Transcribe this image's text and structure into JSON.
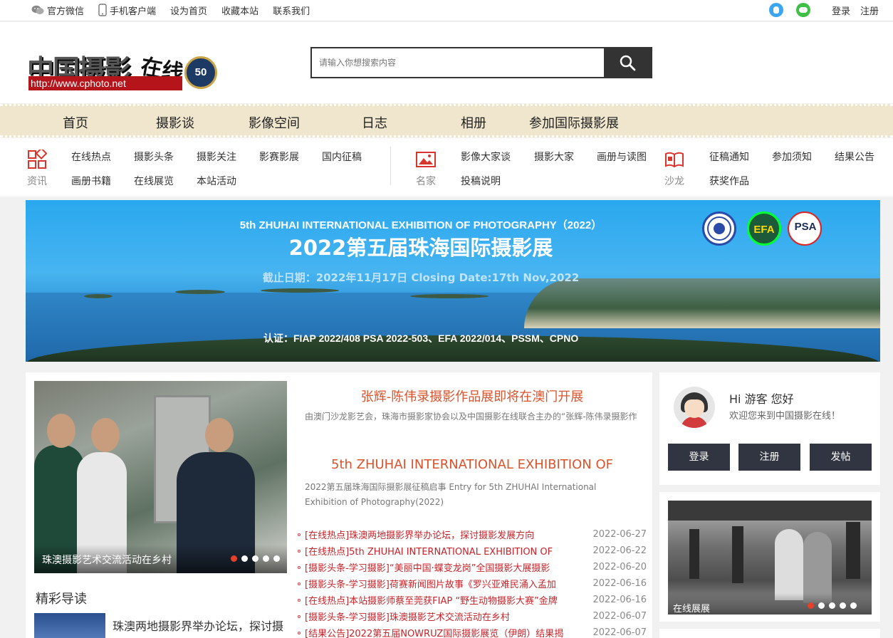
{
  "topbar": {
    "wechat": "官方微信",
    "mobile": "手机客户端",
    "set_home": "设为首页",
    "bookmark": "收藏本站",
    "contact": "联系我们",
    "login": "登录",
    "register": "注册"
  },
  "header": {
    "logo_text": "中国摄影",
    "logo_script": "在线",
    "logo_url": "http://www.cphoto.net",
    "badge": "50",
    "search_placeholder": "请输入你想搜索内容"
  },
  "main_nav": [
    "首页",
    "摄影谈",
    "影像空间",
    "日志",
    "相册",
    "参加国际摄影展"
  ],
  "sub_nav": {
    "news": {
      "label": "资讯",
      "row1": [
        "在线热点",
        "摄影头条",
        "摄影关注",
        "影赛影展",
        "国内征稿"
      ],
      "row2": [
        "画册书籍",
        "在线展览",
        "本站活动"
      ]
    },
    "masters": {
      "label": "名家",
      "row1": [
        "影像大家谈",
        "摄影大家",
        "画册与读图"
      ],
      "row2": [
        "投稿说明"
      ]
    },
    "salon": {
      "label": "沙龙",
      "row1": [
        "征稿通知",
        "参加须知",
        "结果公告"
      ],
      "row2": [
        "获奖作品"
      ]
    }
  },
  "banner": {
    "title_en": "5th ZHUHAI INTERNATIONAL EXHIBITION OF PHOTOGRAPHY（2022）",
    "title_cn": "2022第五届珠海国际摄影展",
    "deadline": "截止日期：2022年11月17日    Closing Date:17th Nov,2022",
    "cert": "认证：FIAP 2022/408 PSA 2022-503、EFA 2022/014、PSSM、CPNO",
    "psa_logo": "PSA"
  },
  "slider": {
    "caption": "珠澳摄影艺术交流活动在乡村",
    "dot_count": 5,
    "active_dot": 0
  },
  "headlines": [
    {
      "title": "张辉-陈伟录摄影作品展即将在澳门开展",
      "summary": "由澳门沙龙影艺会，珠海市摄影家协会以及中国摄影在线联合主办的“张辉-陈伟录摄影作"
    },
    {
      "title": "5th ZHUHAI INTERNATIONAL EXHIBITION OF",
      "summary": "2022第五届珠海国际摄影展征稿启事 Entry for 5th ZHUHAI International Exhibition of Photography(2022)"
    }
  ],
  "news_list": [
    {
      "title": "[在线热点]珠澳两地摄影界举办论坛，探讨摄影发展方向",
      "date": "2022-06-27"
    },
    {
      "title": "[在线热点]5th ZHUHAI INTERNATIONAL EXHIBITION OF",
      "date": "2022-06-22"
    },
    {
      "title": "[摄影头条-学习摄影]“美丽中国·蝶变龙岗”全国摄影大展摄影",
      "date": "2022-06-20"
    },
    {
      "title": "[摄影头条-学习摄影]荷赛新闻图片故事《罗兴亚难民涌入孟加",
      "date": "2022-06-16"
    },
    {
      "title": "[在线热点]本站摄影师蔡至莞获FIAP “野生动物摄影大赛”金牌",
      "date": "2022-06-16"
    },
    {
      "title": "[摄影头条-学习摄影]珠澳摄影艺术交流活动在乡村",
      "date": "2022-06-07"
    },
    {
      "title": "[结果公告]2022第五届NOWRUZ国际摄影展览（伊朗）结果揭",
      "date": "2022-06-07"
    }
  ],
  "featured": {
    "section_title": "精彩导读",
    "item_title": "珠澳两地摄影界举办论坛，探讨摄"
  },
  "user_box": {
    "greeting": "Hi 游客 您好",
    "welcome": "欢迎您来到中国摄影在线！",
    "login": "登录",
    "register": "注册",
    "post": "发帖"
  },
  "online_exhibit": {
    "caption": "在线展展",
    "dot_count": 5,
    "active_dot": 0
  }
}
